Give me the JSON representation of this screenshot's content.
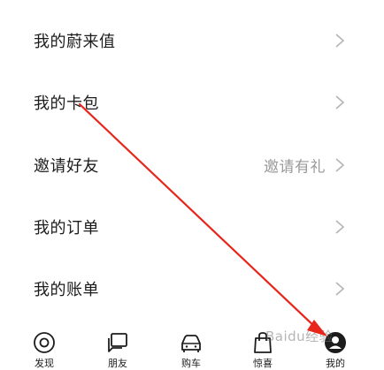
{
  "menu": {
    "items": [
      {
        "label": "我的蔚来值",
        "extra": ""
      },
      {
        "label": "我的卡包",
        "extra": ""
      },
      {
        "label": "邀请好友",
        "extra": "邀请有礼"
      },
      {
        "label": "我的订单",
        "extra": ""
      },
      {
        "label": "我的账单",
        "extra": ""
      }
    ]
  },
  "tabbar": {
    "tabs": [
      {
        "label": "发现",
        "icon": "discover-icon"
      },
      {
        "label": "朋友",
        "icon": "friends-icon"
      },
      {
        "label": "购车",
        "icon": "car-icon"
      },
      {
        "label": "惊喜",
        "icon": "shopping-bag-icon"
      },
      {
        "label": "我的",
        "icon": "profile-icon"
      }
    ]
  },
  "watermark": "Baidu经验",
  "colors": {
    "text": "#1c1c1c",
    "secondary_text": "#9a9a9a",
    "chevron": "#b5b5b5",
    "annotation_arrow": "#e8261c"
  }
}
